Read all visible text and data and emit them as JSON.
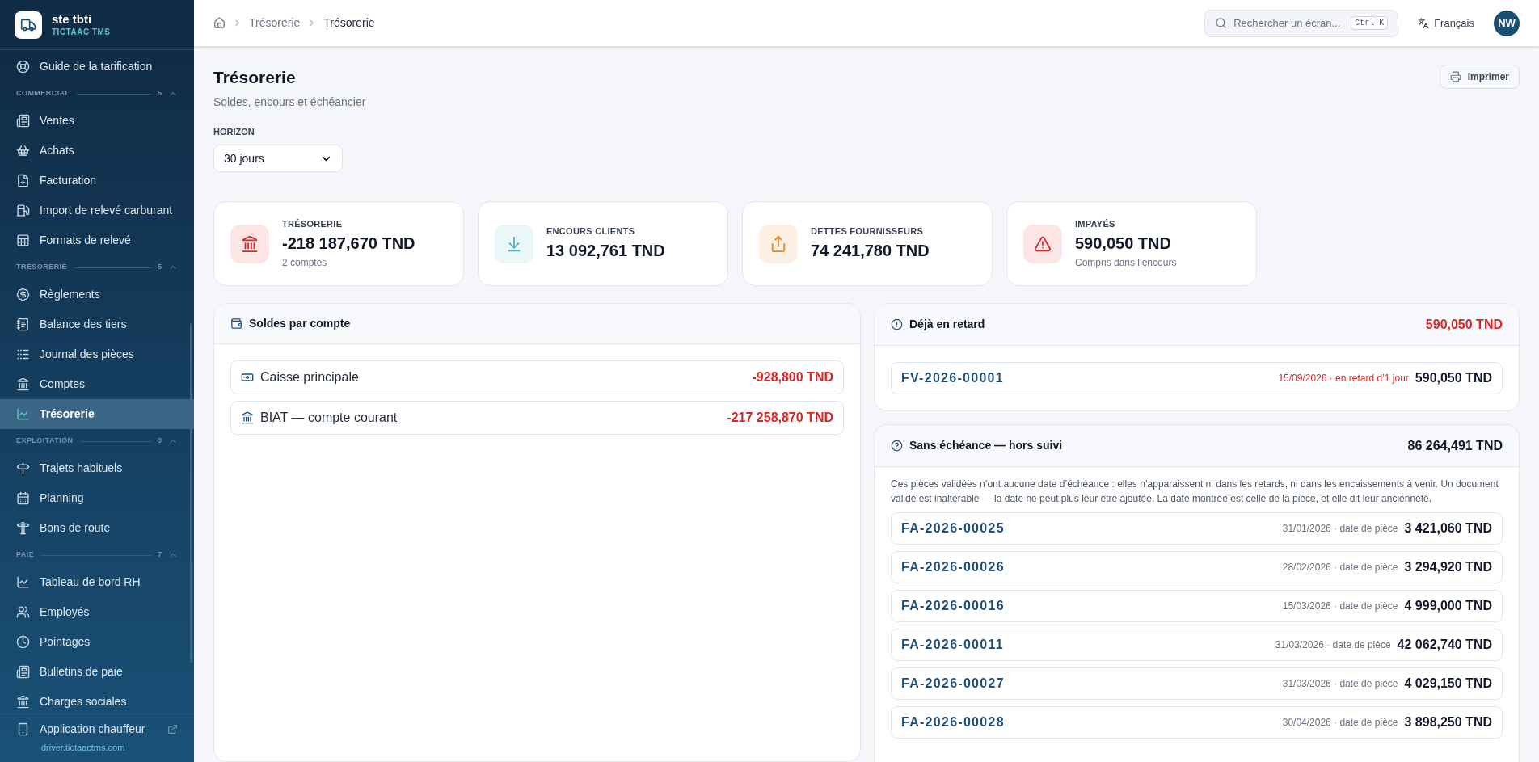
{
  "brand": {
    "name": "ste tbti",
    "subtitle": "TICTAAC TMS"
  },
  "sidebar": {
    "top_items": [
      {
        "label": "Guide de la tarification",
        "selected": false
      }
    ],
    "sections": [
      {
        "title": "COMMERCIAL",
        "count": "5",
        "expanded": true,
        "items": [
          {
            "label": "Ventes",
            "selected": false
          },
          {
            "label": "Achats",
            "selected": false
          },
          {
            "label": "Facturation",
            "selected": false
          },
          {
            "label": "Import de relevé carburant",
            "selected": false
          },
          {
            "label": "Formats de relevé",
            "selected": false
          }
        ]
      },
      {
        "title": "TRÉSORERIE",
        "count": "5",
        "expanded": true,
        "items": [
          {
            "label": "Règlements",
            "selected": false
          },
          {
            "label": "Balance des tiers",
            "selected": false
          },
          {
            "label": "Journal des pièces",
            "selected": false
          },
          {
            "label": "Comptes",
            "selected": false
          },
          {
            "label": "Trésorerie",
            "selected": true
          }
        ]
      },
      {
        "title": "EXPLOITATION",
        "count": "3",
        "expanded": true,
        "items": [
          {
            "label": "Trajets habituels",
            "selected": false
          },
          {
            "label": "Planning",
            "selected": false
          },
          {
            "label": "Bons de route",
            "selected": false
          }
        ]
      },
      {
        "title": "PAIE",
        "count": "7",
        "expanded": true,
        "items": [
          {
            "label": "Tableau de bord RH",
            "selected": false
          },
          {
            "label": "Employés",
            "selected": false
          },
          {
            "label": "Pointages",
            "selected": false
          },
          {
            "label": "Bulletins de paie",
            "selected": false
          },
          {
            "label": "Charges sociales",
            "selected": false
          }
        ]
      }
    ],
    "footer": {
      "label": "Application chauffeur",
      "link": "driver.tictaactms.com"
    }
  },
  "breadcrumb": [
    "Trésorerie",
    "Trésorerie"
  ],
  "search": {
    "placeholder": "Rechercher un écran...",
    "shortcut": "Ctrl K"
  },
  "language": "Français",
  "avatar": "NW",
  "page": {
    "title": "Trésorerie",
    "subtitle": "Soldes, encours et échéancier",
    "print_button": "Imprimer",
    "horizon": {
      "label": "HORIZON",
      "value": "30 jours"
    }
  },
  "kpis": [
    {
      "label": "TRÉSORERIE",
      "value": "-218 187,670 TND",
      "note": "2 comptes",
      "color": "#dc2626"
    },
    {
      "label": "ENCOURS CLIENTS",
      "value": "13 092,761 TND",
      "color": "#4fb3bf"
    },
    {
      "label": "DETTES FOURNISSEURS",
      "value": "74 241,780 TND",
      "color": "#e8871e"
    },
    {
      "label": "IMPAYÉS",
      "value": "590,050 TND",
      "note": "Compris dans l’encours",
      "color": "#dc2626"
    }
  ],
  "accounts": {
    "title": "Soldes par compte",
    "items": [
      {
        "name": "Caisse principale",
        "amount": "-928,800 TND"
      },
      {
        "name": "BIAT — compte courant",
        "amount": "-217 258,870 TND"
      }
    ]
  },
  "overdue": {
    "title": "Déjà en retard",
    "total": "590,050 TND",
    "items": [
      {
        "ref": "FV-2026-00001",
        "note": "15/09/2026 · en retard d’1 jour",
        "amount": "590,050 TND"
      }
    ]
  },
  "undated": {
    "title": "Sans échéance — hors suivi",
    "total": "86 264,491 TND",
    "description": "Ces pièces validées n’ont aucune date d’échéance : elles n’apparaissent ni dans les retards, ni dans les encaissements à venir. Un document validé est inaltérable — la date ne peut plus leur être ajoutée. La date montrée est celle de la pièce, et elle dit leur ancienneté.",
    "items": [
      {
        "ref": "FA-2026-00025",
        "note": "31/01/2026 · date de pièce",
        "amount": "3 421,060 TND"
      },
      {
        "ref": "FA-2026-00026",
        "note": "28/02/2026 · date de pièce",
        "amount": "3 294,920 TND"
      },
      {
        "ref": "FA-2026-00016",
        "note": "15/03/2026 · date de pièce",
        "amount": "4 999,000 TND"
      },
      {
        "ref": "FA-2026-00011",
        "note": "31/03/2026 · date de pièce",
        "amount": "42 062,740 TND"
      },
      {
        "ref": "FA-2026-00027",
        "note": "31/03/2026 · date de pièce",
        "amount": "4 029,150 TND"
      },
      {
        "ref": "FA-2026-00028",
        "note": "30/04/2026 · date de pièce",
        "amount": "3 898,250 TND"
      }
    ]
  }
}
